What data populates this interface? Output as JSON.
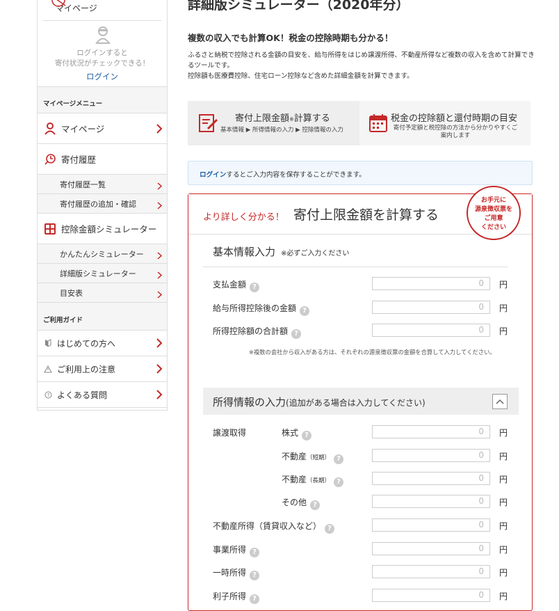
{
  "sidebar": {
    "mypage_top": "マイページ",
    "login_note_1": "ログインすると",
    "login_note_2": "寄付状況がチェックできる！",
    "login_link": "ログイン",
    "menu_head": "マイページメニュー",
    "items": [
      {
        "label": "マイページ"
      },
      {
        "label": "寄付履歴"
      },
      {
        "label": "寄付履歴一覧"
      },
      {
        "label": "寄付履歴の追加・確認"
      },
      {
        "label": "控除金額シミュレーター"
      },
      {
        "label": "かんたんシミュレーター"
      },
      {
        "label": "詳細版シミュレーター"
      },
      {
        "label": "目安表"
      }
    ],
    "guide_head": "ご利用ガイド",
    "guide": [
      {
        "label": "はじめての方へ"
      },
      {
        "label": "ご利用上の注意"
      },
      {
        "label": "よくある質問"
      }
    ]
  },
  "main": {
    "title": "詳細版シミュレーター（2020年分）",
    "lead": "複数の収入でも計算OK！税金の控除時期も分かる！",
    "desc_1": "ふるさと納税で控除される金額の目安を、給与所得をはじめ譲渡所得、不動産所得など複数の収入を含めて計算できるツールです。",
    "desc_2": "控除額も医療費控除、住宅ローン控除など含めた詳細金額を計算できます。",
    "tab1_title": "寄付上限金額",
    "tab1_title_mark": "※",
    "tab1_title_end": "計算する",
    "tab1_sub": "基本情報 ▶ 所得情報の入力 ▶ 控除情報の入力",
    "tab2_title": "税金の控除額と還付時期の目安",
    "tab2_sub": "寄付予定額と税控除の方法から分かりやすくご案内します",
    "notice_link": "ログイン",
    "notice_text": "するとご入力内容を保存することができます。",
    "panel_small": "より詳しく分かる！",
    "panel_large": "寄付上限金額を計算する",
    "badge": [
      "お手元に",
      "源泉徴収票を",
      "ご用意",
      "ください"
    ],
    "basic_title": "基本情報入力",
    "basic_note": "※必ずご入力ください",
    "basic_fields": [
      {
        "label": "支払金額",
        "value": "0",
        "unit": "円"
      },
      {
        "label": "給与所得控除後の金額",
        "value": "0",
        "unit": "円"
      },
      {
        "label": "所得控除額の合計額",
        "value": "0",
        "unit": "円"
      }
    ],
    "basic_small_note": "※複数の会社から収入がある方は、それぞれの源泉徴収票の金額を合算して入力してください。",
    "income_title": "所得情報の入力",
    "income_note": "(追加がある場合は入力してください)",
    "transfer_label": "譲渡取得",
    "transfer_fields": [
      {
        "label": "株式",
        "suffix": "",
        "value": "0",
        "unit": "円"
      },
      {
        "label": "不動産",
        "suffix": "（短期）",
        "value": "0",
        "unit": "円"
      },
      {
        "label": "不動産",
        "suffix": "（長期）",
        "value": "0",
        "unit": "円"
      },
      {
        "label": "その他",
        "suffix": "",
        "value": "0",
        "unit": "円"
      }
    ],
    "other_fields": [
      {
        "label": "不動産所得（賃貸収入など）",
        "value": "0",
        "unit": "円"
      },
      {
        "label": "事業所得",
        "value": "0",
        "unit": "円"
      },
      {
        "label": "一時所得",
        "value": "0",
        "unit": "円"
      },
      {
        "label": "利子所得",
        "value": "0",
        "unit": "円"
      }
    ]
  }
}
